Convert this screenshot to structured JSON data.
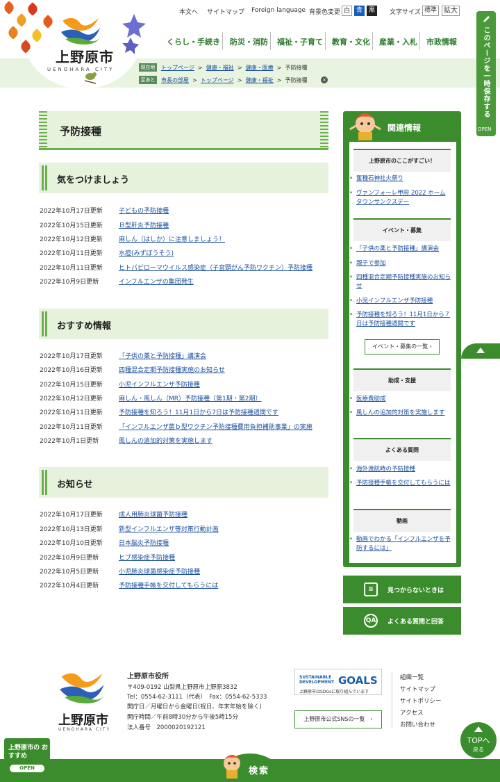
{
  "header": {
    "logo_text": "上野原市",
    "logo_sub": "UENOHARA CITY",
    "util_links": [
      "本文へ",
      "サイトマップ",
      "Foreign language"
    ],
    "bg_label": "背景色変更",
    "bg_options": [
      "白",
      "青",
      "黒"
    ],
    "fontsize_label": "文字サイズ",
    "fontsize_options": [
      "標準",
      "拡大"
    ],
    "global_nav": [
      "くらし・手続き",
      "防災・消防",
      "福祉・子育て",
      "教育・文化",
      "産業・入札",
      "市政情報"
    ],
    "breadcrumb_current_tag": "現在地",
    "breadcrumb_current": [
      "トップページ",
      "健康・福祉",
      "健康・医療",
      "予防接種"
    ],
    "breadcrumb_trail_tag": "足あと",
    "breadcrumb_trail": [
      "市長の部屋",
      "トップページ",
      "健康・福祉",
      "予防接種"
    ],
    "save_tab": "このページを一時保存する",
    "save_open": "OPEN"
  },
  "main": {
    "page_title": "予防接種",
    "sections": [
      {
        "title": "気をつけましょう",
        "rows": [
          {
            "date": "2022年10月17日更新",
            "link": "子どもの予防接種"
          },
          {
            "date": "2022年10月15日更新",
            "link": "Ｂ型肝炎予防接種"
          },
          {
            "date": "2022年10月12日更新",
            "link": "麻しん（はしか）に注意しましょう！"
          },
          {
            "date": "2022年10月11日更新",
            "link": "水痘(みずぼうそう)"
          },
          {
            "date": "2022年10月11日更新",
            "link": "ヒトパピローマウイルス感染症（子宮頸がん予防ワクチン）予防接種"
          },
          {
            "date": "2022年10月9日更新",
            "link": "インフルエンザの集団発生"
          }
        ]
      },
      {
        "title": "おすすめ情報",
        "rows": [
          {
            "date": "2022年10月17日更新",
            "link": "「子供の薬と予防接種」講演会"
          },
          {
            "date": "2022年10月16日更新",
            "link": "四種混合定期予防接種実施のお知らせ"
          },
          {
            "date": "2022年10月15日更新",
            "link": "小児インフルエンザ予防接種"
          },
          {
            "date": "2022年10月12日更新",
            "link": "麻しん・風しん（MR）予防接種（第1期・第2期）"
          },
          {
            "date": "2022年10月11日更新",
            "link": "予防接種を知ろう！11月1日から7日は予防接種週間です"
          },
          {
            "date": "2022年10月11日更新",
            "link": "「インフルエンザ菌ｂ型ワクチン予防接種費用負担補助事業」の実施"
          },
          {
            "date": "2022年10月1日更新",
            "link": "風しんの追加的対策を実施します"
          }
        ]
      },
      {
        "title": "お知らせ",
        "rows": [
          {
            "date": "2022年10月17日更新",
            "link": "成人用肺炎球菌予防接種"
          },
          {
            "date": "2022年10月13日更新",
            "link": "新型インフルエンザ等対策行動計画"
          },
          {
            "date": "2022年10月10日更新",
            "link": "日本脳炎予防接種"
          },
          {
            "date": "2022年10月9日更新",
            "link": "ヒブ感染症予防接種"
          },
          {
            "date": "2022年10月5日更新",
            "link": "小児肺炎球菌感染症予防接種"
          },
          {
            "date": "2022年10月4日更新",
            "link": "予防接種手帳を交付してもらうには"
          }
        ]
      }
    ]
  },
  "related": {
    "title": "関連情報",
    "groups": [
      {
        "title": "上野原市のここがすごい！",
        "links": [
          "奮種石神社火祭り",
          "ヴァンフォーレ甲府 2022 ホームタウンサンクスデー"
        ]
      },
      {
        "title": "イベント・募集",
        "links": [
          "「子供の薬と予防接種」講演会",
          "親子で参加",
          "四種混合定期予防接種実施のお知らせ",
          "小児インフルエンザ予防接種",
          "予防接種を知ろう！11月1日から７日は予防接種週間です"
        ]
      },
      {
        "title": "助成・支援",
        "links": [
          "医療費助成",
          "風しんの追加的対策を実施します"
        ]
      },
      {
        "title": "よくある質問",
        "links": [
          "海外渡航時の予防接種",
          "予防接種手帳を交付してもらうには"
        ]
      },
      {
        "title": "動画",
        "links": [
          "動画でわかる「インフルエンザを予防するには」"
        ]
      }
    ],
    "more_button": "イベント・募集の一覧",
    "not_found": "見つからないときは",
    "faq": "よくある質問と回答"
  },
  "footer": {
    "org": "上野原市役所",
    "address": "〒409-0192 山梨県上野原市上野原3832",
    "tel": "Tel：0554-62-3111（代表）　Fax：0554-62-5333",
    "open_days": "開庁日／月曜日から金曜日(祝日、年末年始を除く)",
    "open_hours": "開庁時間／午前8時30分から午後5時15分",
    "corp_no": "法人番号　2000020192121",
    "sdg_a": "SUSTAINABLE DEVELOPMENT",
    "sdg_b": "GOALS",
    "sdg_c": "上野原市はSDGsに取り組んでいます",
    "sns": "上野原市公式SNSの一覧",
    "links": [
      "組織一覧",
      "サイトマップ",
      "サイトポリシー",
      "アクセス",
      "お問い合わせ"
    ],
    "top_label": "TOPへ",
    "top_sub": "戻る",
    "search": "検索",
    "osusume": "上野原市の おすすめ",
    "osusume_open": "OPEN"
  },
  "colors": {
    "brand_green": "#3b8c2c",
    "light_green": "#e6f2dc",
    "link": "#1a4fa0"
  }
}
